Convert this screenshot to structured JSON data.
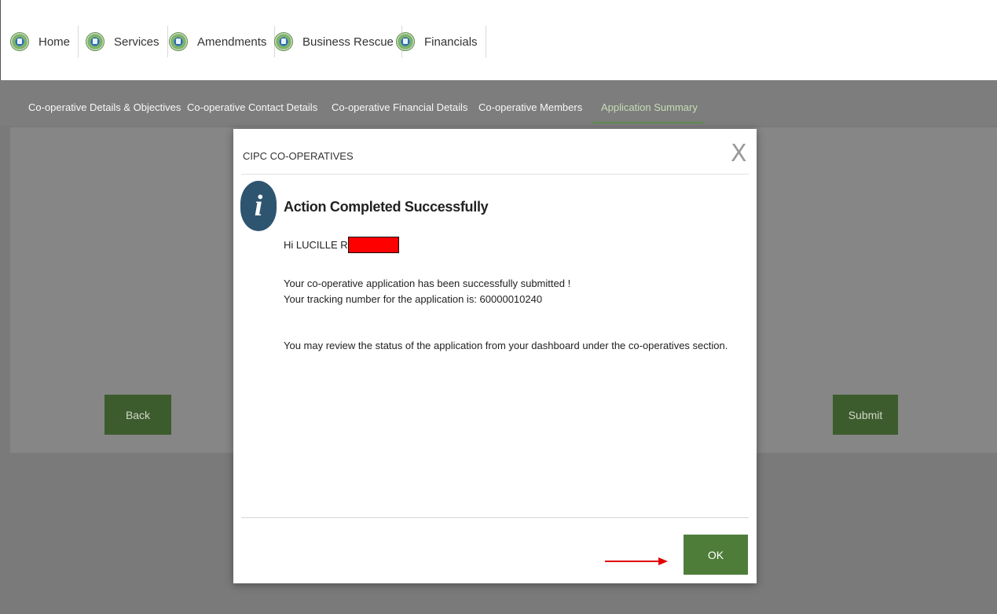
{
  "nav": {
    "items": [
      {
        "label": "Home",
        "icon": "cipc-logo-icon"
      },
      {
        "label": "Services",
        "icon": "cipc-logo-icon"
      },
      {
        "label": "Amendments",
        "icon": "cipc-logo-icon"
      },
      {
        "label": "Business Rescue",
        "icon": "cipc-logo-icon"
      },
      {
        "label": "Financials",
        "icon": "cipc-logo-icon"
      }
    ]
  },
  "subtabs": [
    {
      "label": "Co-operative Details & Objectives"
    },
    {
      "label": "Co-operative Contact Details"
    },
    {
      "label": "Co-operative Financial Details"
    },
    {
      "label": "Co-operative Members"
    },
    {
      "label": "Application Summary",
      "active": true
    }
  ],
  "page_buttons": {
    "back": "Back",
    "submit": "Submit"
  },
  "modal": {
    "title": "CIPC CO-OPERATIVES",
    "close": "X",
    "info_icon": "i",
    "heading": "Action Completed Successfully",
    "greeting": "Hi LUCILLE R",
    "line1": "Your co-operative application has been successfully submitted !",
    "line2": "Your tracking number for the application is: 60000010240",
    "line3": "You may review the status of the application from your dashboard under the co-operatives section.",
    "ok": "OK"
  },
  "colors": {
    "accent_green": "#4e7d3a",
    "info_blue": "#2e5570",
    "redaction": "#ff0000",
    "arrow": "#e00000"
  }
}
